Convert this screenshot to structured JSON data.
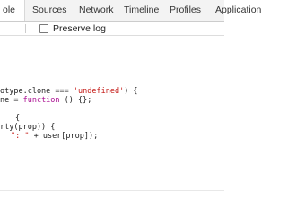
{
  "tabs": [
    {
      "label": "ole",
      "active": true
    },
    {
      "label": "Sources",
      "active": false
    },
    {
      "label": "Network",
      "active": false
    },
    {
      "label": "Timeline",
      "active": false
    },
    {
      "label": "Profiles",
      "active": false
    },
    {
      "label": "Application",
      "active": false
    }
  ],
  "toolbar": {
    "preserve_log_label": "Preserve log",
    "preserve_log_checked": false
  },
  "code": {
    "line1": {
      "pre": "otype.clone === ",
      "str": "'undefined'",
      "post": ") {"
    },
    "line2": {
      "pre": "ne = ",
      "kw": "function",
      "post": " () {};"
    },
    "line3": "{",
    "line4": "rty(prop)) {",
    "line5": {
      "str": "\": \"",
      "post": " + user[prop]);"
    }
  },
  "colors": {
    "string": "#c41a16",
    "keyword": "#aa0d91",
    "active_tab_bg": "#ffffff",
    "tabbar_bg": "#f3f3f3"
  }
}
